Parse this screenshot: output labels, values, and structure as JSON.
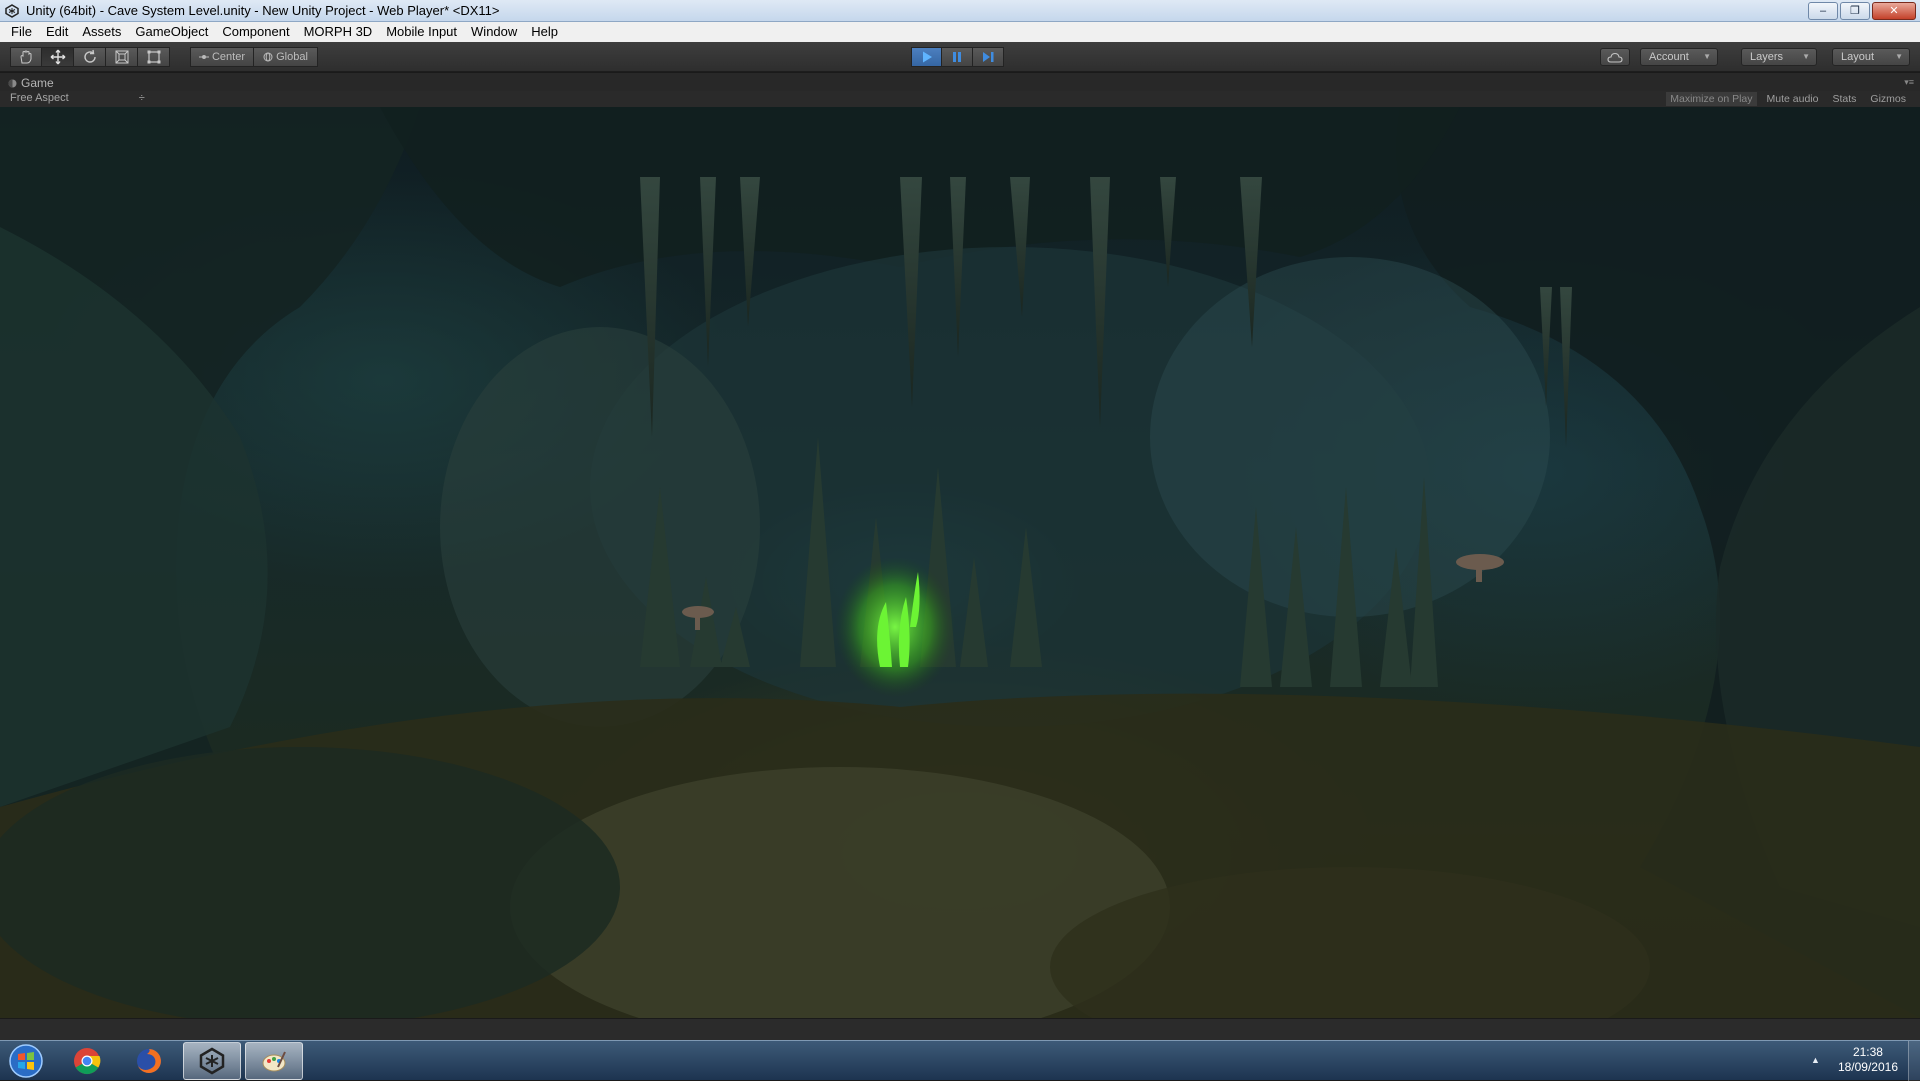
{
  "window": {
    "title": "Unity (64bit) - Cave System Level.unity - New Unity Project - Web Player* <DX11>",
    "app_icon": "unity-icon",
    "controls": {
      "minimize": "–",
      "maximize": "❐",
      "close": "✕"
    }
  },
  "menu": {
    "items": [
      "File",
      "Edit",
      "Assets",
      "GameObject",
      "Component",
      "MORPH 3D",
      "Mobile Input",
      "Window",
      "Help"
    ]
  },
  "toolbar": {
    "tools": [
      "hand-tool-icon",
      "move-tool-icon",
      "rotate-tool-icon",
      "scale-tool-icon",
      "rect-tool-icon"
    ],
    "pivot": {
      "center": "Center",
      "global": "Global"
    },
    "play": {
      "playing": true
    },
    "account": "Account",
    "layers": "Layers",
    "layout": "Layout"
  },
  "game_panel": {
    "tab_label": "Game",
    "aspect": "Free Aspect",
    "aspect_caret": "÷",
    "maximize_on_play": "Maximize on Play",
    "mute_audio": "Mute audio",
    "stats": "Stats",
    "gizmos": "Gizmos"
  },
  "taskbar": {
    "apps": [
      "windows-start-icon",
      "chrome-icon",
      "firefox-icon",
      "unity-icon",
      "paint-icon"
    ],
    "clock_time": "21:38",
    "clock_date": "18/09/2016",
    "tray_arrow": "▲"
  },
  "colors": {
    "unity_dark": "#2e2e2e",
    "play_blue": "#3f74b5",
    "glow_green": "#44d21c",
    "taskbar_blue": "#1d3450"
  }
}
